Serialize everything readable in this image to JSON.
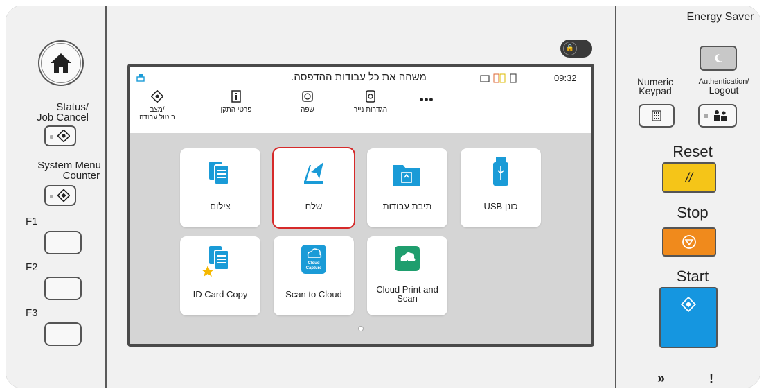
{
  "left_panel": {
    "status_label_line1": "Status/",
    "status_label_line2": "Job Cancel",
    "system_label_line1": "System Menu",
    "system_label_line2": "Counter",
    "f1": "F1",
    "f2": "F2",
    "f3": "F3"
  },
  "screen": {
    "message": "משהה את כל עבודות ההדפסה.",
    "time": "09:32",
    "toolbar": [
      {
        "label_line1": "מצב/",
        "label_line2": "ביטול עבודה",
        "icon": "status-icon"
      },
      {
        "label_line1": "פרטי התקן",
        "label_line2": "",
        "icon": "device-info-icon"
      },
      {
        "label_line1": "שפה",
        "label_line2": "",
        "icon": "language-icon"
      },
      {
        "label_line1": "הגדרות נייר",
        "label_line2": "",
        "icon": "paper-settings-icon"
      },
      {
        "label_line1": "•••",
        "label_line2": "",
        "icon": "more-icon"
      }
    ],
    "tiles": [
      {
        "label": "צילום",
        "icon": "copy-icon"
      },
      {
        "label": "שלח",
        "icon": "send-icon"
      },
      {
        "label": "תיבת עבודות",
        "icon": "job-box-icon"
      },
      {
        "label": "כונן USB",
        "icon": "usb-icon"
      },
      {
        "label": "ID Card Copy",
        "icon": "id-card-copy-icon"
      },
      {
        "label": "Scan to Cloud",
        "icon": "scan-to-cloud-icon",
        "badge_line1": "Cloud",
        "badge_line2": "Capture"
      },
      {
        "label_line1": "Cloud Print and",
        "label_line2": "Scan",
        "icon": "cloud-print-scan-icon"
      }
    ],
    "selected_tile": "שלח"
  },
  "right_panel": {
    "energy_saver": "Energy Saver",
    "numeric_keypad_line1": "Numeric",
    "numeric_keypad_line2": "Keypad",
    "auth_line1": "Authentication/",
    "auth_line2": "Logout",
    "reset": "Reset",
    "stop": "Stop",
    "start": "Start",
    "processing_indicator": "»",
    "attention_indicator": "!"
  },
  "colors": {
    "accent_blue": "#1a9bd7",
    "reset_yellow": "#f5c518",
    "stop_orange": "#f08a1c",
    "start_blue": "#1596e0",
    "copy_tile_blue": "#1a9bd7",
    "cloud_green": "#1f9e6e",
    "selection_red": "#d62a2a"
  }
}
